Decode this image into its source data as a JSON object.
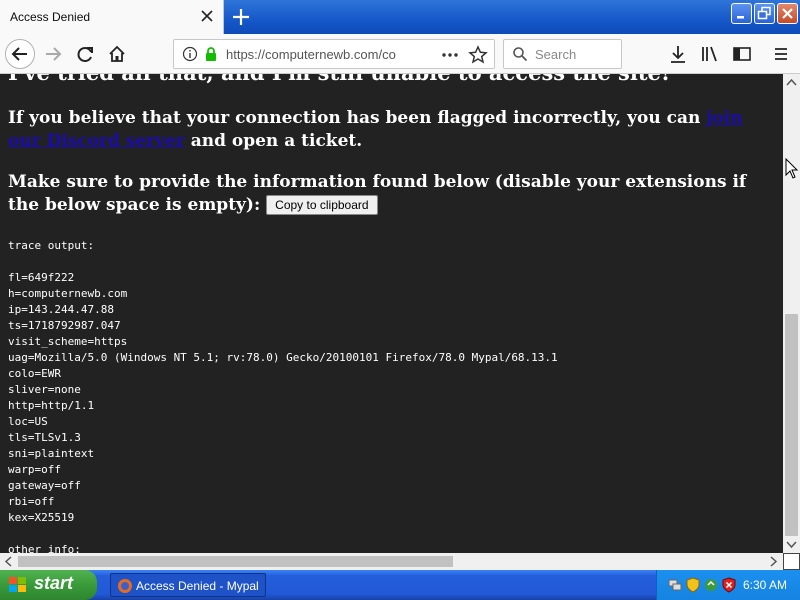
{
  "tab": {
    "title": "Access Denied"
  },
  "nav": {
    "url": "https://computernewb.com/co",
    "search_placeholder": "Search"
  },
  "content": {
    "partial_heading": "I've tried all that, and I'm still unable to access the site!",
    "para1_pre": "If you believe that your connection has been flagged incorrectly, you can ",
    "para1_link": "join our Discord server",
    "para1_post": " and open a ticket.",
    "para2": "Make sure to provide the information found below (disable your extensions if the below space is empty): ",
    "copy_button": "Copy to clipboard",
    "trace_output": "trace output:\n\nfl=649f222\nh=computernewb.com\nip=143.244.47.88\nts=1718792987.047\nvisit_scheme=https\nuag=Mozilla/5.0 (Windows NT 5.1; rv:78.0) Gecko/20100101 Firefox/78.0 Mypal/68.13.1\ncolo=EWR\nsliver=none\nhttp=http/1.1\nloc=US\ntls=TLSv1.3\nsni=plaintext\nwarp=off\ngateway=off\nrbi=off\nkex=X25519\n\nother info:"
  },
  "taskbar": {
    "start_label": "start",
    "task_label": "Access Denied - Mypal",
    "clock": "6:30 AM"
  },
  "colors": {
    "page_bg": "#222222",
    "link": "#1a0dab",
    "titlebar": "#1657c9",
    "taskbar": "#245edb",
    "start": "#3a9a3a"
  }
}
